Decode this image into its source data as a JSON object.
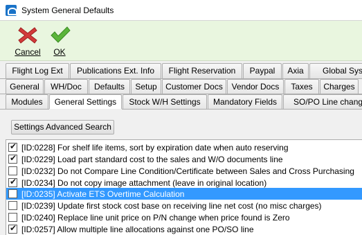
{
  "window": {
    "title": "System General Defaults"
  },
  "toolbar": {
    "cancel_label": "Cancel",
    "ok_label": "OK"
  },
  "tabs": {
    "row1": [
      "Flight Log Ext",
      "Publications Ext. Info",
      "Flight Reservation",
      "Paypal",
      "Axia",
      "Global Syste"
    ],
    "row2": [
      "General",
      "WH/Doc",
      "Defaults",
      "Setup",
      "Customer Docs",
      "Vendor Docs",
      "Taxes",
      "Charges"
    ],
    "row3": [
      "Modules",
      "General Settings",
      "Stock W/H Settings",
      "Mandatory Fields",
      "SO/PO Line changes"
    ],
    "active_row3": "General Settings"
  },
  "settings": {
    "advanced_search_label": "Settings Advanced Search",
    "items": [
      {
        "label": "[ID:0228] For shelf life items, sort by expiration date when auto reserving",
        "checked": true,
        "selected": false
      },
      {
        "label": "[ID:0229] Load part standard cost to the sales and W/O documents line",
        "checked": true,
        "selected": false
      },
      {
        "label": "[ID:0232] Do not Compare Line Condition/Certificate between Sales and Cross Purchasing",
        "checked": false,
        "selected": false
      },
      {
        "label": "[ID:0234] Do not copy image attachment (leave in original location)",
        "checked": true,
        "selected": false
      },
      {
        "label": "[ID:0235] Activate ETS Overtime Calculation",
        "checked": false,
        "selected": true
      },
      {
        "label": "[ID:0239] Update first stock cost base on receiving line net cost (no misc charges)",
        "checked": false,
        "selected": false
      },
      {
        "label": "[ID:0240] Replace line unit price on P/N change when price found is Zero",
        "checked": false,
        "selected": false
      },
      {
        "label": "[ID:0257] Allow multiple line allocations against one PO/SO line",
        "checked": true,
        "selected": false
      }
    ]
  },
  "colors": {
    "toolbar_bg": "#e9f6df",
    "selection": "#3399ff"
  }
}
